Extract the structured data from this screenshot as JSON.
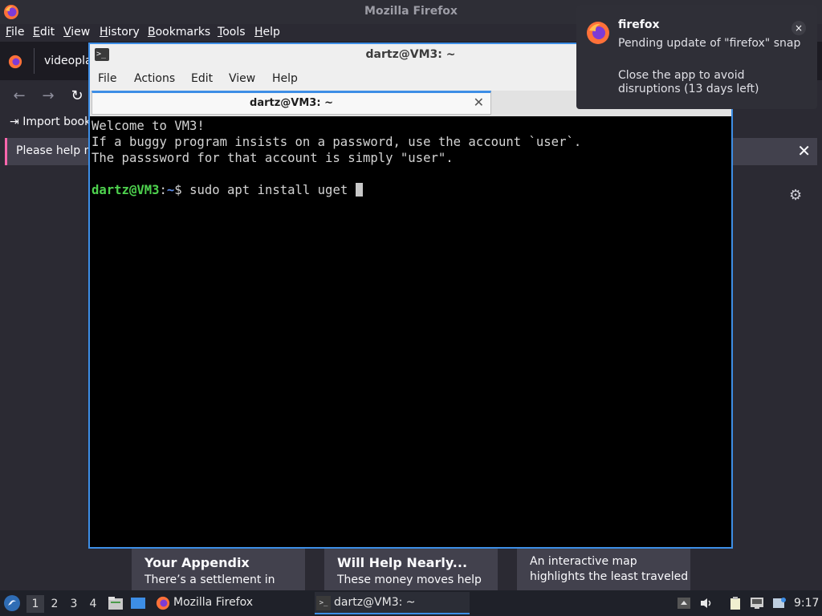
{
  "firefox": {
    "window_title": "Mozilla Firefox",
    "menu": [
      "File",
      "Edit",
      "View",
      "History",
      "Bookmarks",
      "Tools",
      "Help"
    ],
    "tab_label": "videopla",
    "bookmarks_item": "Import book",
    "notice_text": "Please help m",
    "cards": [
      {
        "title": "Your Appendix",
        "text": "There’s a settlement in"
      },
      {
        "title": "Will Help Nearly...",
        "text": "These money moves help"
      },
      {
        "lines": [
          "An interactive map",
          "highlights the least traveled"
        ]
      }
    ]
  },
  "terminal": {
    "window_title": "dartz@VM3: ~",
    "menu": [
      "File",
      "Actions",
      "Edit",
      "View",
      "Help"
    ],
    "tab_title": "dartz@VM3: ~",
    "lines": [
      "Welcome to VM3!",
      "If a buggy program insists on a password, use the account `user`.",
      "The passsword for that account is simply \"user\".",
      ""
    ],
    "prompt_user": "dartz@VM3",
    "prompt_sep": ":",
    "prompt_path": "~",
    "prompt_symbol": "$ ",
    "command": "sudo apt install uget "
  },
  "notification": {
    "app": "firefox",
    "message": "Pending update of \"firefox\" snap",
    "detail": "Close the app to avoid disruptions (13 days left)",
    "close_label": "×"
  },
  "taskbar": {
    "workspaces": [
      "1",
      "2",
      "3",
      "4"
    ],
    "active_workspace": "1",
    "tasks": [
      {
        "label": "Mozilla Firefox",
        "icon": "firefox-icon"
      },
      {
        "label": "dartz@VM3: ~",
        "icon": "terminal-icon"
      }
    ],
    "clock": "9:17"
  },
  "colors": {
    "accent": "#3d8ee6",
    "prompt_user": "#4ed24e",
    "prompt_path": "#5c8ae6"
  }
}
